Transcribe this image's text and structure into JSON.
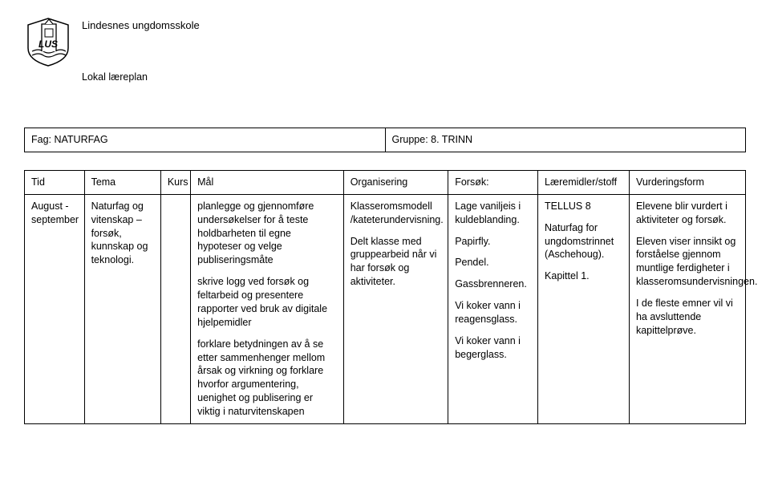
{
  "header": {
    "school_name": "Lindesnes ungdomsskole",
    "subtitle": "Lokal læreplan"
  },
  "meta": {
    "fag_label": "Fag: NATURFAG",
    "gruppe_label": "Gruppe: 8. TRINN"
  },
  "columns": {
    "tid": "Tid",
    "tema": "Tema",
    "kurs": "Kurs",
    "maal": "Mål",
    "organisering": "Organisering",
    "forsok": "Forsøk:",
    "laeremidler": "Læremidler/stoff",
    "vurdering": "Vurderingsform"
  },
  "row": {
    "tid": "August - september",
    "tema": "Naturfag og vitenskap – forsøk, kunnskap og teknologi.",
    "kurs": "",
    "maal": {
      "g1": "planlegge og gjennomføre undersøkelser for å teste holdbarheten til egne hypoteser og velge publiseringsmåte",
      "g2": "skrive logg ved forsøk og feltarbeid og presentere rapporter ved bruk av digitale hjelpemidler",
      "g3": "forklare betydningen av å se etter sammenhenger mellom årsak og virkning og forklare hvorfor argumentering, uenighet og publisering er viktig i naturvitenskapen"
    },
    "organisering": {
      "o1": "Klasseromsmodell /kateterundervisning.",
      "o2": "Delt klasse med gruppearbeid når vi har forsøk og aktiviteter."
    },
    "forsok": {
      "f1": "Lage vaniljeis i kuldeblanding.",
      "f2": "Papirfly.",
      "f3": "Pendel.",
      "f4": "Gassbrenneren.",
      "f5": "Vi koker vann i reagensglass.",
      "f6": "Vi koker vann i begerglass."
    },
    "laeremidler": {
      "l1": "TELLUS 8",
      "l2": "Naturfag for ungdomstrinnet (Aschehoug).",
      "l3": "Kapittel 1."
    },
    "vurdering": {
      "v1": "Elevene blir vurdert i aktiviteter og forsøk.",
      "v2": "Eleven viser innsikt og forståelse gjennom muntlige ferdigheter i klasseromsundervisningen.",
      "v3": "I de fleste emner vil vi ha avsluttende kapittelprøve."
    }
  }
}
